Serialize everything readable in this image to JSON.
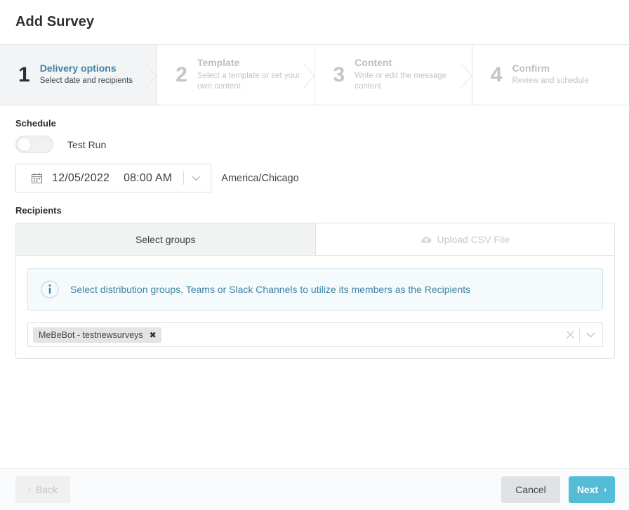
{
  "header": {
    "title": "Add Survey"
  },
  "wizard": {
    "steps": [
      {
        "num": "1",
        "label": "Delivery options",
        "desc": "Select date and recipients",
        "state": "active"
      },
      {
        "num": "2",
        "label": "Template",
        "desc": "Select a template or set your own content",
        "state": "inactive"
      },
      {
        "num": "3",
        "label": "Content",
        "desc": "Write or edit the message content",
        "state": "inactive"
      },
      {
        "num": "4",
        "label": "Confirm",
        "desc": "Review and schedule",
        "state": "inactive"
      }
    ]
  },
  "schedule": {
    "section_label": "Schedule",
    "test_run_label": "Test Run",
    "test_run_on": false,
    "date": "12/05/2022",
    "time": "08:00 AM",
    "timezone": "America/Chicago",
    "calendar_icon": "calendar-icon",
    "caret_icon": "chevron-down-icon"
  },
  "recipients": {
    "section_label": "Recipients",
    "tabs": [
      {
        "label": "Select groups",
        "active": true
      },
      {
        "label": "Upload CSV File",
        "active": false,
        "icon": "cloud-upload-icon"
      }
    ],
    "info": {
      "icon": "info-circle-icon",
      "text": "Select distribution groups, Teams or Slack Channels to utilize its members as the Recipients"
    },
    "select": {
      "chips": [
        {
          "label": "MeBeBot - testnewsurveys",
          "remove": "✖"
        }
      ],
      "clear_icon": "clear-x-icon",
      "caret_icon": "chevron-down-icon"
    }
  },
  "footer": {
    "back_label": "Back",
    "back_arrow": "‹",
    "cancel_label": "Cancel",
    "next_label": "Next",
    "next_arrow": "›"
  },
  "colors": {
    "accent": "#3f82a6",
    "next_button": "#54bcd6",
    "active_step_bg": "#f3f4f5",
    "info_bg": "#f5fbfc",
    "info_border": "#cfe3ea"
  }
}
